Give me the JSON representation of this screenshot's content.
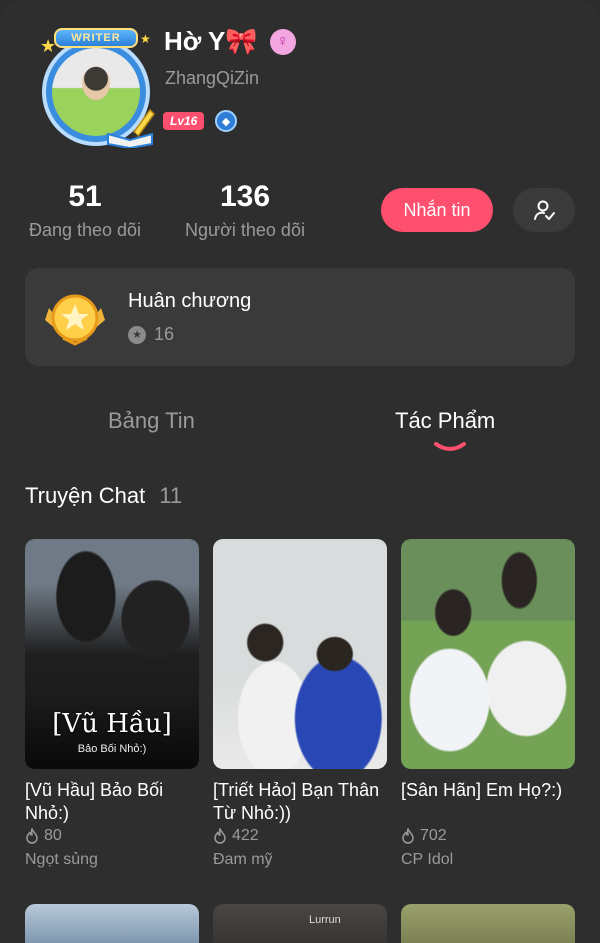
{
  "profile": {
    "display_name": "Hờ Y🎀",
    "username": "ZhangQiZin",
    "level": "Lv16",
    "writer_label": "WRITER"
  },
  "stats": {
    "following_count": "51",
    "following_label": "Đang theo dõi",
    "followers_count": "136",
    "followers_label": "Người theo dõi"
  },
  "actions": {
    "message_label": "Nhắn tin"
  },
  "medals": {
    "title": "Huân chương",
    "count": "16"
  },
  "tabs": [
    {
      "label": "Bảng Tin",
      "active": false
    },
    {
      "label": "Tác Phẩm",
      "active": true
    }
  ],
  "section": {
    "title": "Truyện Chat",
    "count": "11"
  },
  "stories": [
    {
      "title": "[Vũ Hầu] Bảo Bối Nhỏ:)",
      "views": "80",
      "tag": "Ngọt sủng",
      "thumb_title": "[Vũ Hầu]",
      "thumb_subtitle": "Bảo Bối Nhỏ:)"
    },
    {
      "title": "[Triết Hảo] Bạn Thân Từ Nhỏ:))",
      "views": "422",
      "tag": "Đam mỹ"
    },
    {
      "title": "[Sân Hãn] Em Họ?:)",
      "views": "702",
      "tag": "CP Idol"
    }
  ],
  "bottom_row": {
    "thumb2_label": "Lurrun"
  },
  "colors": {
    "accent": "#ff4f6e",
    "background": "#2e2e2e",
    "card": "#3a3a3a",
    "muted_text": "#9a9a9a"
  }
}
